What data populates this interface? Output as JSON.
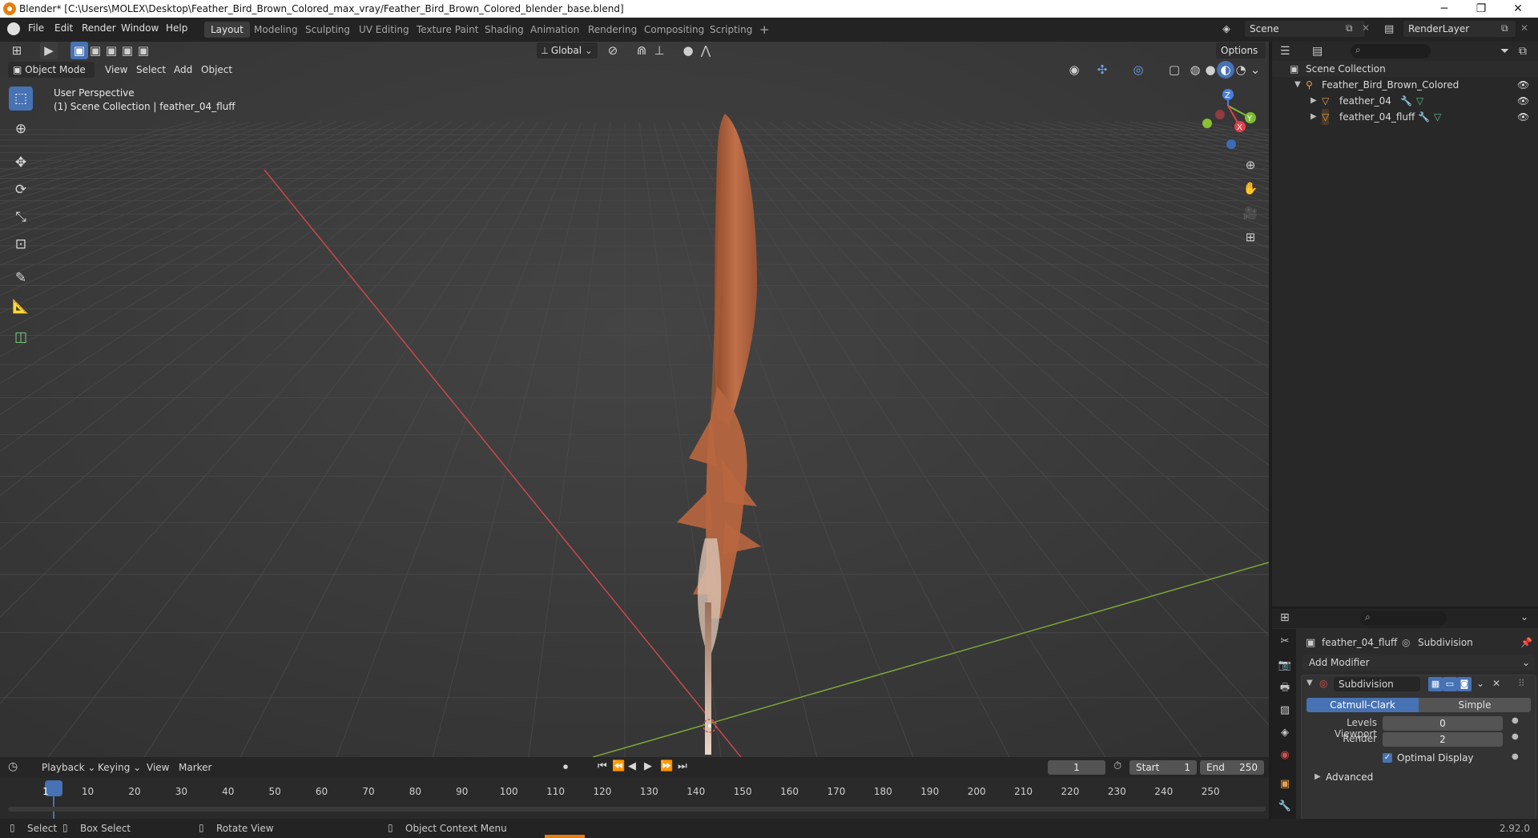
{
  "window": {
    "title": "Blender* [C:\\Users\\MOLEX\\Desktop\\Feather_Bird_Brown_Colored_max_vray/Feather_Bird_Brown_Colored_blender_base.blend]",
    "controls": {
      "minimize": "─",
      "maximize": "❐",
      "close": "✕"
    }
  },
  "menubar": {
    "menus": [
      "File",
      "Edit",
      "Render",
      "Window",
      "Help"
    ],
    "workspaces": [
      "Layout",
      "Modeling",
      "Sculpting",
      "UV Editing",
      "Texture Paint",
      "Shading",
      "Animation",
      "Rendering",
      "Compositing",
      "Scripting"
    ],
    "active_workspace": "Layout",
    "add_tab": "+",
    "scene": "Scene",
    "render_layer": "RenderLayer"
  },
  "viewport": {
    "mode": "Object Mode",
    "menus": [
      "View",
      "Select",
      "Add",
      "Object"
    ],
    "transform_orientation": "Global",
    "options_label": "Options",
    "info_line1": "User Perspective",
    "info_line2": "(1) Scene Collection | feather_04_fluff",
    "gizmo_axes": {
      "z": "Z",
      "y": "Y",
      "x": "X"
    },
    "colors": {
      "background": "#3c3c3c",
      "x_axis": "#c8484f",
      "y_axis": "#7fa43a",
      "feather": "#b9663f"
    }
  },
  "outliner": {
    "root": "Scene Collection",
    "collection": "Feather_Bird_Brown_Colored",
    "objects": [
      {
        "name": "feather_04"
      },
      {
        "name": "feather_04_fluff"
      }
    ]
  },
  "properties": {
    "object_name": "feather_04_fluff",
    "modifier_context": "Subdivision",
    "add_modifier_label": "Add Modifier",
    "modifier": {
      "name": "Subdivision",
      "type_options": [
        "Catmull-Clark",
        "Simple"
      ],
      "active_type": "Catmull-Clark",
      "levels_viewport_label": "Levels Viewport",
      "levels_viewport": "0",
      "render_label": "Render",
      "render": "2",
      "optimal_display_label": "Optimal Display",
      "optimal_display": true,
      "advanced_label": "Advanced"
    }
  },
  "timeline": {
    "menus": [
      "Playback",
      "Keying",
      "View",
      "Marker"
    ],
    "current_frame": "1",
    "start_label": "Start",
    "start": "1",
    "end_label": "End",
    "end": "250",
    "ticks": [
      "1",
      "10",
      "20",
      "30",
      "40",
      "50",
      "60",
      "70",
      "80",
      "90",
      "100",
      "110",
      "120",
      "130",
      "140",
      "150",
      "160",
      "170",
      "180",
      "190",
      "200",
      "210",
      "220",
      "230",
      "240",
      "250"
    ]
  },
  "statusbar": {
    "select": "Select",
    "box_select": "Box Select",
    "rotate_view": "Rotate View",
    "context_menu": "Object Context Menu",
    "version": "2.92.0"
  }
}
